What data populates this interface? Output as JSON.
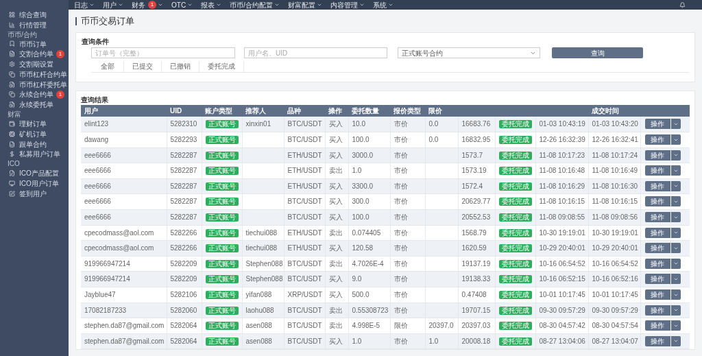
{
  "top_nav": [
    {
      "label": "日志"
    },
    {
      "label": "用户"
    },
    {
      "label": "财务",
      "badge": "1"
    },
    {
      "label": "OTC"
    },
    {
      "label": "报表"
    },
    {
      "label": "币币/合约配置"
    },
    {
      "label": "财富配置"
    },
    {
      "label": "内容管理"
    },
    {
      "label": "系统"
    }
  ],
  "sidebar": [
    {
      "items": [
        "综合查询",
        "行情管理"
      ]
    },
    {
      "title": "币币/合约",
      "items": [
        "币币订单",
        {
          "label": "交割合约单",
          "badge": "1"
        },
        "交割期设置",
        "币币杠杆合约单",
        "币币杠杆委托单",
        {
          "label": "永续合约单",
          "badge": "1"
        },
        "永续委托单"
      ]
    },
    {
      "title": "财富",
      "items": [
        "理财订单",
        "矿机订单",
        "跟单合约",
        "私募用户订单"
      ]
    },
    {
      "title": "ICO",
      "items": [
        "ICO产品配置",
        "ICO用户订单",
        "签到用户"
      ]
    }
  ],
  "page_title": "币币交易订单",
  "search": {
    "title": "查询条件",
    "order_field": {
      "placeholder": "订单号（完整）"
    },
    "user_field": {
      "placeholder": "用户名、UID"
    },
    "account_select": {
      "value": "正式账号合约"
    },
    "button": "查询",
    "tabs": [
      {
        "label": "全部",
        "selected": false
      },
      {
        "label": "已提交",
        "selected": false
      },
      {
        "label": "已撤销",
        "selected": false
      },
      {
        "label": "委托完成",
        "selected": false
      }
    ]
  },
  "results": {
    "title": "查询结果",
    "header_left": [
      "用户",
      "UID",
      "账户类型",
      "推荐人",
      "品种",
      "操作",
      "委托数量",
      "报价类型",
      "限价"
    ],
    "header_right": [
      "成交时间"
    ],
    "rows": [
      {
        "user": "elint123",
        "uid": "5282310",
        "account_type": "正式账号",
        "referrer": "xinxin01",
        "symbol": "BTC/USDT",
        "side": "买入",
        "quantity": "10.0",
        "price_type": "市价",
        "limit_price": "0.0",
        "avg_price": "16683.76",
        "status": "委托完成",
        "order_time": "01-03 10:43:19",
        "trade_time": "01-03 10:43:20",
        "action": "操作"
      },
      {
        "user": "dawang",
        "uid": "5282293",
        "account_type": "正式账号",
        "symbol": "BTC/USDT",
        "side": "买入",
        "quantity": "100.0",
        "price_type": "市价",
        "limit_price": "0.0",
        "avg_price": "16832.95",
        "status": "委托完成",
        "order_time": "12-26 16:32:39",
        "trade_time": "12-26 16:32:41",
        "action": "操作"
      },
      {
        "user": "eee6666",
        "uid": "5282287",
        "account_type": "正式账号",
        "symbol": "ETH/USDT",
        "side": "买入",
        "quantity": "3000.0",
        "price_type": "市价",
        "avg_price": "1573.7",
        "status": "委托完成",
        "order_time": "11-08 10:17:23",
        "trade_time": "11-08 10:17:24",
        "action": "操作"
      },
      {
        "user": "eee6666",
        "uid": "5282287",
        "account_type": "正式账号",
        "symbol": "ETH/USDT",
        "side": "卖出",
        "quantity": "1.0",
        "price_type": "市价",
        "avg_price": "1573.19",
        "status": "委托完成",
        "order_time": "11-08 10:16:48",
        "trade_time": "11-08 10:16:49",
        "action": "操作"
      },
      {
        "user": "eee6666",
        "uid": "5282287",
        "account_type": "正式账号",
        "symbol": "ETH/USDT",
        "side": "买入",
        "quantity": "3300.0",
        "price_type": "市价",
        "avg_price": "1572.4",
        "status": "委托完成",
        "order_time": "11-08 10:16:29",
        "trade_time": "11-08 10:16:30",
        "action": "操作"
      },
      {
        "user": "eee6666",
        "uid": "5282287",
        "account_type": "正式账号",
        "symbol": "BTC/USDT",
        "side": "买入",
        "quantity": "300.0",
        "price_type": "市价",
        "avg_price": "20629.77",
        "status": "委托完成",
        "order_time": "11-08 10:16:15",
        "trade_time": "11-08 10:16:15",
        "action": "操作"
      },
      {
        "user": "eee6666",
        "uid": "5282287",
        "account_type": "正式账号",
        "symbol": "BTC/USDT",
        "side": "买入",
        "quantity": "100.0",
        "price_type": "市价",
        "avg_price": "20552.53",
        "status": "委托完成",
        "order_time": "11-08 09:08:55",
        "trade_time": "11-08 09:08:56",
        "action": "操作"
      },
      {
        "user": "cpecodmass@aol.com",
        "uid": "5282266",
        "account_type": "正式账号",
        "referrer": "tiechui088",
        "symbol": "ETH/USDT",
        "side": "卖出",
        "quantity": "0.074405",
        "price_type": "市价",
        "avg_price": "1568.79",
        "status": "委托完成",
        "order_time": "10-30 19:19:01",
        "trade_time": "10-30 19:19:01",
        "action": "操作"
      },
      {
        "user": "cpecodmass@aol.com",
        "uid": "5282266",
        "account_type": "正式账号",
        "referrer": "tiechui088",
        "symbol": "ETH/USDT",
        "side": "买入",
        "quantity": "120.58",
        "price_type": "市价",
        "avg_price": "1620.59",
        "status": "委托完成",
        "order_time": "10-29 20:40:01",
        "trade_time": "10-29 20:40:01",
        "action": "操作"
      },
      {
        "user": "919966947214",
        "uid": "5282209",
        "account_type": "正式账号",
        "referrer": "Stephen088",
        "symbol": "BTC/USDT",
        "side": "卖出",
        "quantity": "4.7026E-4",
        "price_type": "市价",
        "avg_price": "19137.19",
        "status": "委托完成",
        "order_time": "10-16 06:54:52",
        "trade_time": "10-16 06:54:52",
        "action": "操作"
      },
      {
        "user": "919966947214",
        "uid": "5282209",
        "account_type": "正式账号",
        "referrer": "Stephen088",
        "symbol": "BTC/USDT",
        "side": "买入",
        "quantity": "9.0",
        "price_type": "市价",
        "avg_price": "19138.33",
        "status": "委托完成",
        "order_time": "10-16 06:52:15",
        "trade_time": "10-16 06:52:16",
        "action": "操作"
      },
      {
        "user": "Jayblue47",
        "uid": "5282106",
        "account_type": "正式账号",
        "referrer": "yifan088",
        "symbol": "XRP/USDT",
        "side": "买入",
        "quantity": "500.0",
        "price_type": "市价",
        "avg_price": "0.47408",
        "status": "委托完成",
        "order_time": "10-01 10:17:45",
        "trade_time": "10-01 10:17:45",
        "action": "操作"
      },
      {
        "user": "17082187233",
        "uid": "5282060",
        "account_type": "正式账号",
        "referrer": "laohu088",
        "symbol": "BTC/USDT",
        "side": "卖出",
        "quantity": "0.55308723",
        "price_type": "市价",
        "avg_price": "19707.15",
        "status": "委托完成",
        "order_time": "09-30 09:57:29",
        "trade_time": "09-30 09:57:29",
        "action": "操作"
      },
      {
        "user": "stephen.da87@gmail.com",
        "uid": "5282064",
        "account_type": "正式账号",
        "referrer": "asen088",
        "symbol": "BTC/USDT",
        "side": "卖出",
        "quantity": "4.998E-5",
        "price_type": "限价",
        "limit_price": "20397.0",
        "avg_price": "20397.03",
        "status": "委托完成",
        "order_time": "08-30 04:57:42",
        "trade_time": "08-30 04:57:54",
        "action": "操作"
      },
      {
        "user": "stephen.da87@gmail.com",
        "uid": "5282064",
        "account_type": "正式账号",
        "referrer": "asen088",
        "symbol": "BTC/USDT",
        "side": "买入",
        "quantity": "1.0",
        "price_type": "市价",
        "limit_price": "1.0",
        "avg_price": "20008.18",
        "status": "委托完成",
        "order_time": "08-27 13:04:06",
        "trade_time": "08-27 13:04:07",
        "action": "操作"
      }
    ]
  }
}
